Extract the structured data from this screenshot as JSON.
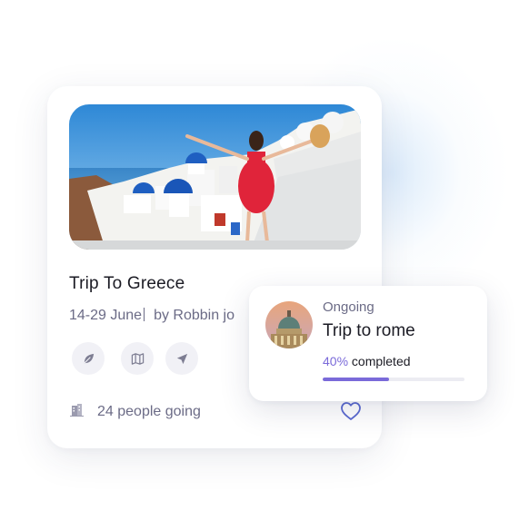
{
  "trip_card": {
    "title": "Trip To Greece",
    "dates": "14-29 June",
    "author": "by Robbin jo",
    "actions": [
      {
        "icon": "leaf-icon"
      },
      {
        "icon": "map-icon"
      },
      {
        "icon": "send-icon"
      }
    ],
    "people_icon": "building-icon",
    "people_going": "24 people going",
    "favorite_icon": "heart-icon"
  },
  "ongoing_card": {
    "status": "Ongoing",
    "title": "Trip to rome",
    "progress_percent_label": "40%",
    "progress_text": " completed",
    "progress": 0.47
  },
  "colors": {
    "accent": "#7a6ad9",
    "text_primary": "#1b1b24",
    "text_secondary": "#6b6b86",
    "icon_bg": "#f1f1f6",
    "heart": "#5b6ad0"
  }
}
